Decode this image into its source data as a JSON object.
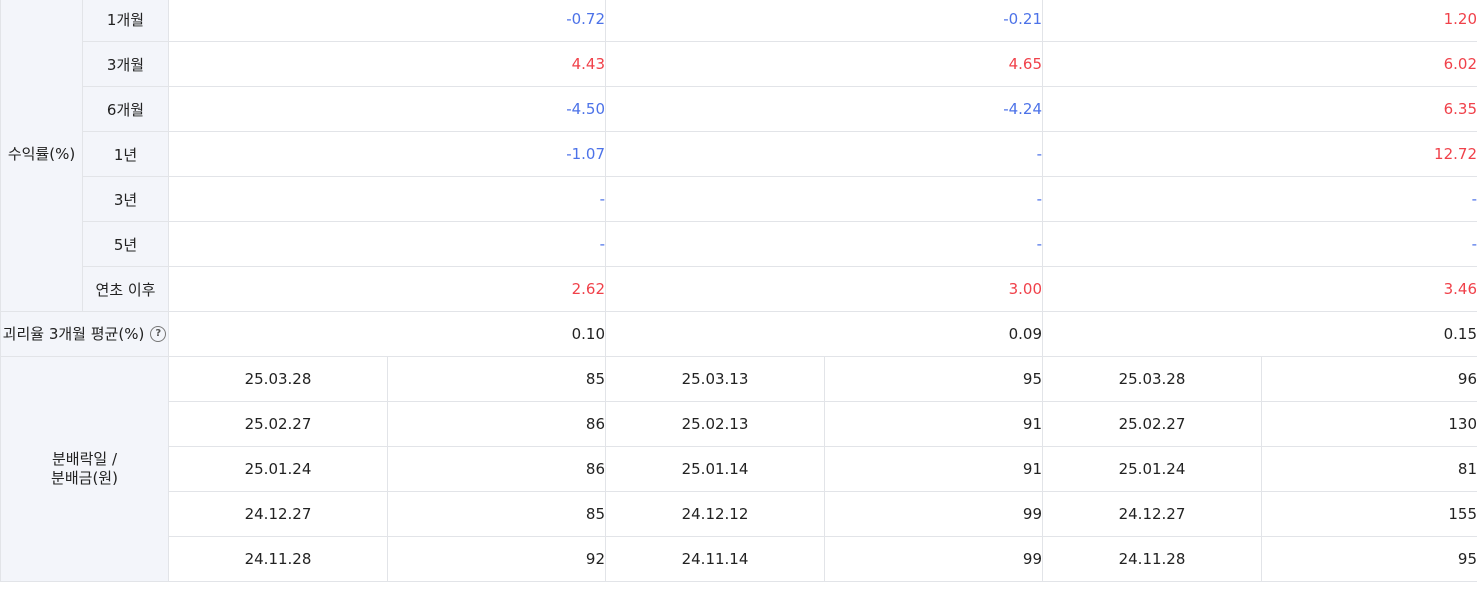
{
  "returns": {
    "group_label": "수익률(%)",
    "rows": [
      {
        "label": "1개월",
        "values": [
          "-0.72",
          "-0.21",
          "1.20"
        ]
      },
      {
        "label": "3개월",
        "values": [
          "4.43",
          "4.65",
          "6.02"
        ]
      },
      {
        "label": "6개월",
        "values": [
          "-4.50",
          "-4.24",
          "6.35"
        ]
      },
      {
        "label": "1년",
        "values": [
          "-1.07",
          "-",
          "12.72"
        ]
      },
      {
        "label": "3년",
        "values": [
          "-",
          "-",
          "-"
        ]
      },
      {
        "label": "5년",
        "values": [
          "-",
          "-",
          "-"
        ]
      },
      {
        "label": "연초 이후",
        "values": [
          "2.62",
          "3.00",
          "3.46"
        ]
      }
    ]
  },
  "tracking_error": {
    "label": "괴리율 3개월 평균(%)",
    "help_icon": "question-circle-icon",
    "values": [
      "0.10",
      "0.09",
      "0.15"
    ]
  },
  "distribution": {
    "label_line1": "분배락일 /",
    "label_line2": "분배금(원)",
    "rows": [
      {
        "funds": [
          {
            "date": "25.03.28",
            "amount": "85"
          },
          {
            "date": "25.03.13",
            "amount": "95"
          },
          {
            "date": "25.03.28",
            "amount": "96"
          }
        ]
      },
      {
        "funds": [
          {
            "date": "25.02.27",
            "amount": "86"
          },
          {
            "date": "25.02.13",
            "amount": "91"
          },
          {
            "date": "25.02.27",
            "amount": "130"
          }
        ]
      },
      {
        "funds": [
          {
            "date": "25.01.24",
            "amount": "86"
          },
          {
            "date": "25.01.14",
            "amount": "91"
          },
          {
            "date": "25.01.24",
            "amount": "81"
          }
        ]
      },
      {
        "funds": [
          {
            "date": "24.12.27",
            "amount": "85"
          },
          {
            "date": "24.12.12",
            "amount": "99"
          },
          {
            "date": "24.12.27",
            "amount": "155"
          }
        ]
      },
      {
        "funds": [
          {
            "date": "24.11.28",
            "amount": "92"
          },
          {
            "date": "24.11.14",
            "amount": "99"
          },
          {
            "date": "24.11.28",
            "amount": "95"
          }
        ]
      }
    ]
  },
  "colors": {
    "positive": "#f0414a",
    "negative": "#4c72e8",
    "header_bg": "#f3f5fa",
    "border": "#e2e4e8"
  }
}
